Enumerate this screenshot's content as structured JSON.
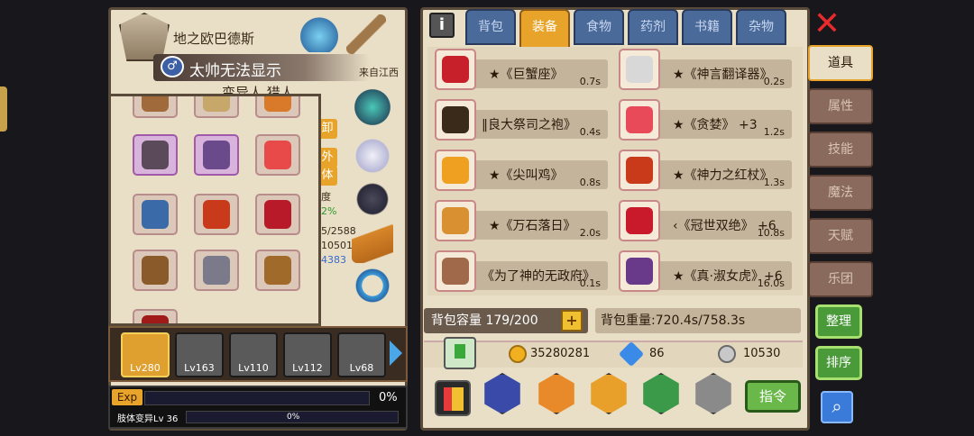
{
  "profile": {
    "region": "地之欧巴德斯",
    "gender_symbol": "♂",
    "player_name": "太帅无法显示",
    "origin": "来自江西",
    "subtitle": "变异人 猎人",
    "side_tags": [
      "卸",
      "外",
      "体"
    ],
    "stats": [
      "度",
      "2%",
      "5/2588",
      "10501",
      "4383"
    ]
  },
  "heroes": [
    {
      "level": "Lv280",
      "selected": true
    },
    {
      "level": "Lv163",
      "selected": false
    },
    {
      "level": "Lv110",
      "selected": false
    },
    {
      "level": "Lv112",
      "selected": false
    },
    {
      "level": "Lv68",
      "selected": false
    }
  ],
  "exp": {
    "label": "Exp",
    "percent": "0%",
    "mutation_label": "肢体变异Lv 36",
    "mutation_percent": "0%"
  },
  "tabs": [
    {
      "label": "背包",
      "active": false
    },
    {
      "label": "装备",
      "active": true
    },
    {
      "label": "食物",
      "active": false
    },
    {
      "label": "药剂",
      "active": false
    },
    {
      "label": "书籍",
      "active": false
    },
    {
      "label": "杂物",
      "active": false
    }
  ],
  "items": [
    {
      "name": "★《巨蟹座》",
      "weight": "0.7s",
      "color": "#c8202a"
    },
    {
      "name": "★《神言翻译器》",
      "weight": "0.2s",
      "color": "#d8d8d8"
    },
    {
      "name": "‖良大祭司之袍》",
      "weight": "0.4s",
      "color": "#3a2a1a"
    },
    {
      "name": "★《贪婪》 +3",
      "weight": "1.2s",
      "color": "#e84a5a"
    },
    {
      "name": "★《尖叫鸡》",
      "weight": "0.8s",
      "color": "#f0a020"
    },
    {
      "name": "★《神力之红杖》",
      "weight": "1.3s",
      "color": "#c83a1a"
    },
    {
      "name": "★《万石落日》",
      "weight": "2.0s",
      "color": "#d89030"
    },
    {
      "name": "‹《冠世双绝》 +6",
      "weight": "10.8s",
      "color": "#c81a2a"
    },
    {
      "name": "《为了神的无政府》",
      "weight": "0.1s",
      "color": "#a06a4a"
    },
    {
      "name": "★《真·淑女虎》+6",
      "weight": "16.0s",
      "color": "#6a3a8a"
    }
  ],
  "capacity": {
    "label": "背包容量 179/200",
    "plus": "+"
  },
  "weight": {
    "label": "背包重量:720.4s/758.3s"
  },
  "currency": {
    "gold": "35280281",
    "gems": "86",
    "silver": "10530"
  },
  "command_label": "指令",
  "side_tabs": [
    {
      "label": "道具",
      "active": true
    },
    {
      "label": "属性",
      "active": false
    },
    {
      "label": "技能",
      "active": false
    },
    {
      "label": "魔法",
      "active": false
    },
    {
      "label": "天赋",
      "active": false
    },
    {
      "label": "乐团",
      "active": false
    }
  ],
  "actions": {
    "organize": "整理",
    "sort": "排序"
  },
  "info_label": "i",
  "close_label": "✕",
  "search_label": "⌕",
  "inventory_slots": [
    "hammer-icon",
    "helmet-icon",
    "pot-icon",
    "ring-icon",
    "purple-gem-icon",
    "flower-icon",
    "cannon-icon",
    "flame-claw-icon",
    "red-pot-icon",
    "boot-icon",
    "armor-icon",
    "chest-icon"
  ]
}
